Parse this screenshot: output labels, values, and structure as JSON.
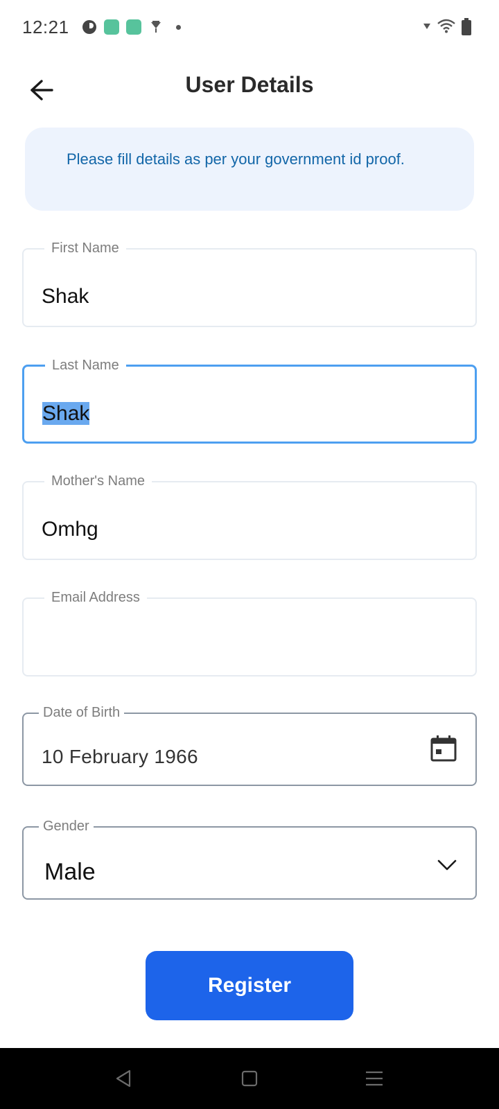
{
  "status_bar": {
    "time": "12:21"
  },
  "header": {
    "title": "User Details",
    "back_icon": "arrow-left-icon"
  },
  "info_banner": {
    "text": "Please fill details as per your government id proof."
  },
  "form": {
    "first_name": {
      "label": "First Name",
      "value": "Shak"
    },
    "last_name": {
      "label": "Last Name",
      "value": "Shak"
    },
    "mothers_name": {
      "label": "Mother's Name",
      "value": "Omhg"
    },
    "email": {
      "label": "Email Address",
      "value": ""
    },
    "dob": {
      "label": "Date of Birth",
      "value": "10 February 1966",
      "icon": "calendar-icon"
    },
    "gender": {
      "label": "Gender",
      "value": "Male",
      "icon": "chevron-down-icon"
    }
  },
  "actions": {
    "register_label": "Register"
  },
  "colors": {
    "primary": "#1d64ea",
    "banner_bg": "#edf3fd",
    "banner_text": "#1266a8",
    "focus_border": "#4d9ff0",
    "selection": "#6aa9ef"
  }
}
